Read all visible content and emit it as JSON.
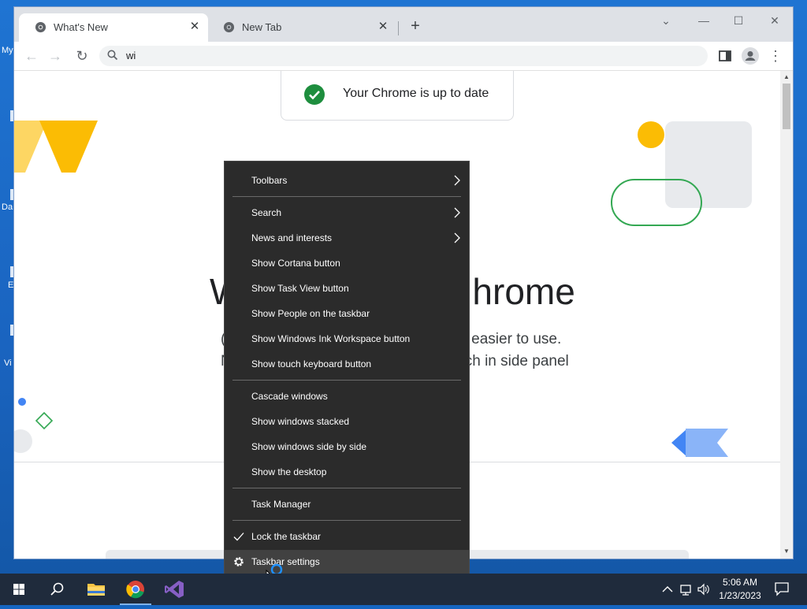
{
  "desktop": {
    "icon_labels": [
      "My",
      "Da",
      "E",
      "Vi"
    ]
  },
  "browser": {
    "tabs": [
      {
        "title": "What's New",
        "active": true
      },
      {
        "title": "New Tab",
        "active": false
      }
    ],
    "new_tab_label": "+",
    "address_bar_text": "wi",
    "page": {
      "update_message": "Your Chrome is up to date",
      "headline_left": "W",
      "headline_right": "hrome",
      "subline_1_left": "(",
      "subline_1_right": "d easier to use.",
      "subline_2_left": "N",
      "subline_2_right": "ch in side panel"
    }
  },
  "context_menu": {
    "items": [
      {
        "label": "Toolbars",
        "submenu": true
      },
      {
        "label": "Search",
        "submenu": true
      },
      {
        "label": "News and interests",
        "submenu": true
      },
      {
        "label": "Show Cortana button"
      },
      {
        "label": "Show Task View button"
      },
      {
        "label": "Show People on the taskbar"
      },
      {
        "label": "Show Windows Ink Workspace button"
      },
      {
        "label": "Show touch keyboard button"
      },
      {
        "label": "Cascade windows"
      },
      {
        "label": "Show windows stacked"
      },
      {
        "label": "Show windows side by side"
      },
      {
        "label": "Show the desktop"
      },
      {
        "label": "Task Manager"
      },
      {
        "label": "Lock the taskbar",
        "checked": true
      },
      {
        "label": "Taskbar settings",
        "icon": "gear-icon",
        "hovered": true
      }
    ]
  },
  "taskbar": {
    "apps": [
      "windows-start-icon",
      "search-icon",
      "file-explorer-icon",
      "chrome-icon",
      "visual-studio-icon"
    ],
    "active_app": "chrome-icon",
    "clock_time": "5:06 AM",
    "clock_date": "1/23/2023"
  },
  "colors": {
    "menu_bg": "#2b2b2b",
    "taskbar_bg": "#1f2b3c",
    "accent_green": "#1e8e3e",
    "accent_yellow": "#fbbc04",
    "accent_blue": "#4285f4"
  }
}
